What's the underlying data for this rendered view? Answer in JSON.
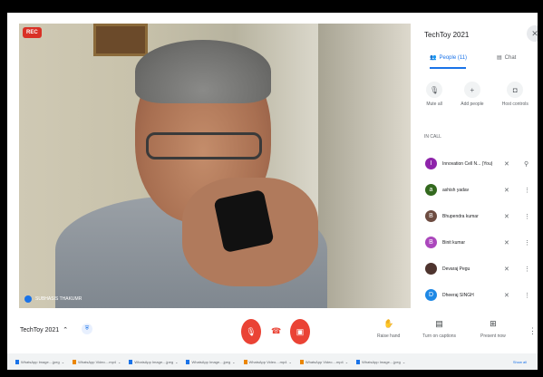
{
  "recording_badge": "REC",
  "tile_name": "SUBHASIS THAKUMR",
  "panel": {
    "title": "TechToy 2021",
    "tab_people": "People (11)",
    "tab_chat": "Chat",
    "actions": [
      "Mute all",
      "Add people",
      "Host controls"
    ],
    "section": "IN CALL",
    "people": [
      {
        "initial": "I",
        "name": "Innovation Cell N... (You)",
        "color": "#8e24aa"
      },
      {
        "initial": "a",
        "name": "ashish yadav",
        "color": "#33691e"
      },
      {
        "initial": "B",
        "name": "Bhupendra kumar",
        "color": "#6d4c41"
      },
      {
        "initial": "B",
        "name": "Binit kumar",
        "color": "#ab47bc"
      },
      {
        "initial": "",
        "name": "Devaraj Pegu",
        "color": "#4e342e"
      },
      {
        "initial": "D",
        "name": "Dheeraj SINGH",
        "color": "#1e88e5"
      }
    ]
  },
  "bottom": {
    "meeting": "TechToy 2021",
    "raise_hand": "Raise hand",
    "captions": "Turn on captions",
    "present": "Present now"
  },
  "downloads": [
    "WhatsApp Image....jpeg",
    "WhatsApp Video....mp4",
    "WhatsApp Image....jpeg",
    "WhatsApp Image....jpeg",
    "WhatsApp Video....mp4",
    "WhatsApp Video....mp4",
    "WhatsApp Image....jpeg"
  ],
  "show_all": "Show all",
  "icons": {
    "people": "people-icon",
    "chat": "chat-icon",
    "mute_all": "mic-off-icon",
    "add_people": "person-add-icon",
    "host_controls": "lock-icon",
    "mic": "mic-off-icon",
    "camera": "camera-off-icon",
    "hangup": "phone-icon",
    "raise": "hand-icon",
    "captions": "cc-icon",
    "present": "present-icon"
  }
}
